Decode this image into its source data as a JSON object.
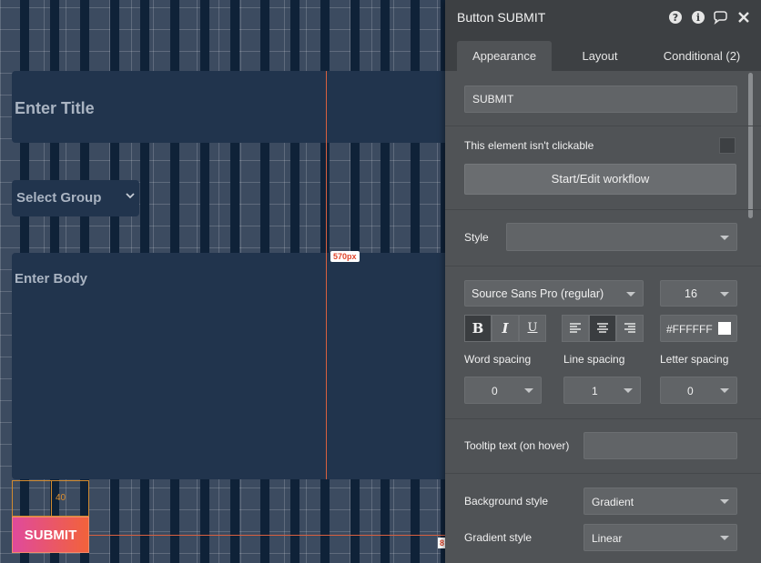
{
  "canvas": {
    "title_placeholder": "Enter Title",
    "group_placeholder": "Select Group",
    "body_placeholder": "Enter Body",
    "submit_label": "SUBMIT",
    "width_badge": "570px",
    "spacing_value": "40",
    "bottom_badge": "8"
  },
  "panel": {
    "title": "Button SUBMIT",
    "icons": [
      "help-icon",
      "info-icon",
      "comment-icon",
      "close-icon"
    ],
    "tabs": [
      {
        "label": "Appearance"
      },
      {
        "label": "Layout"
      },
      {
        "label": "Conditional (2)"
      }
    ],
    "text_value": "SUBMIT",
    "not_clickable_label": "This element isn't clickable",
    "workflow_button": "Start/Edit workflow",
    "style_label": "Style",
    "style_value": "",
    "font_family": "Source Sans Pro (regular)",
    "font_size": "16",
    "format_buttons": [
      "B",
      "I",
      "U"
    ],
    "font_color": "#FFFFFF",
    "word_spacing_label": "Word spacing",
    "line_spacing_label": "Line spacing",
    "letter_spacing_label": "Letter spacing",
    "word_spacing_value": "0",
    "line_spacing_value": "1",
    "letter_spacing_value": "0",
    "tooltip_label": "Tooltip text (on hover)",
    "tooltip_value": "",
    "background_style_label": "Background style",
    "background_style_value": "Gradient",
    "gradient_style_label": "Gradient style",
    "gradient_style_value": "Linear"
  },
  "colors": {
    "button_gradient_start": "#e04a9c",
    "button_gradient_end": "#f2623a",
    "guide": "#d9603f"
  }
}
